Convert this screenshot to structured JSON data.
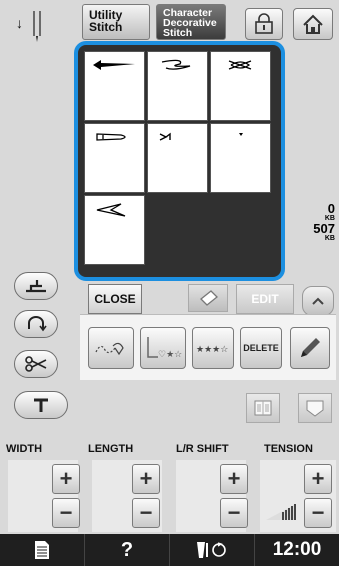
{
  "header": {
    "utility_tab": "Utility\nStitch",
    "character_tab": "Character\nDecorative\nStitch"
  },
  "memory": {
    "used": "0",
    "used_unit": "KB",
    "free": "507",
    "free_unit": "KB"
  },
  "actions": {
    "close_label": "CLOSE",
    "edit_label": "EDIT",
    "delete_label": "DELETE"
  },
  "controls": {
    "width_label": "WIDTH",
    "length_label": "LENGTH",
    "lr_shift_label": "L/R SHIFT",
    "tension_label": "TENSION",
    "plus": "+",
    "minus": "−"
  },
  "status_bar": {
    "help": "?",
    "time": "12:00"
  },
  "stitch_cells": [
    {
      "icon": "stitch-pattern-1-icon"
    },
    {
      "icon": "stitch-pattern-2-icon"
    },
    {
      "icon": "stitch-pattern-3-icon"
    },
    {
      "icon": "stitch-pattern-4-icon"
    },
    {
      "icon": "stitch-pattern-5-icon"
    },
    {
      "icon": "stitch-pattern-6-icon"
    },
    {
      "icon": "stitch-pattern-7-icon"
    }
  ]
}
